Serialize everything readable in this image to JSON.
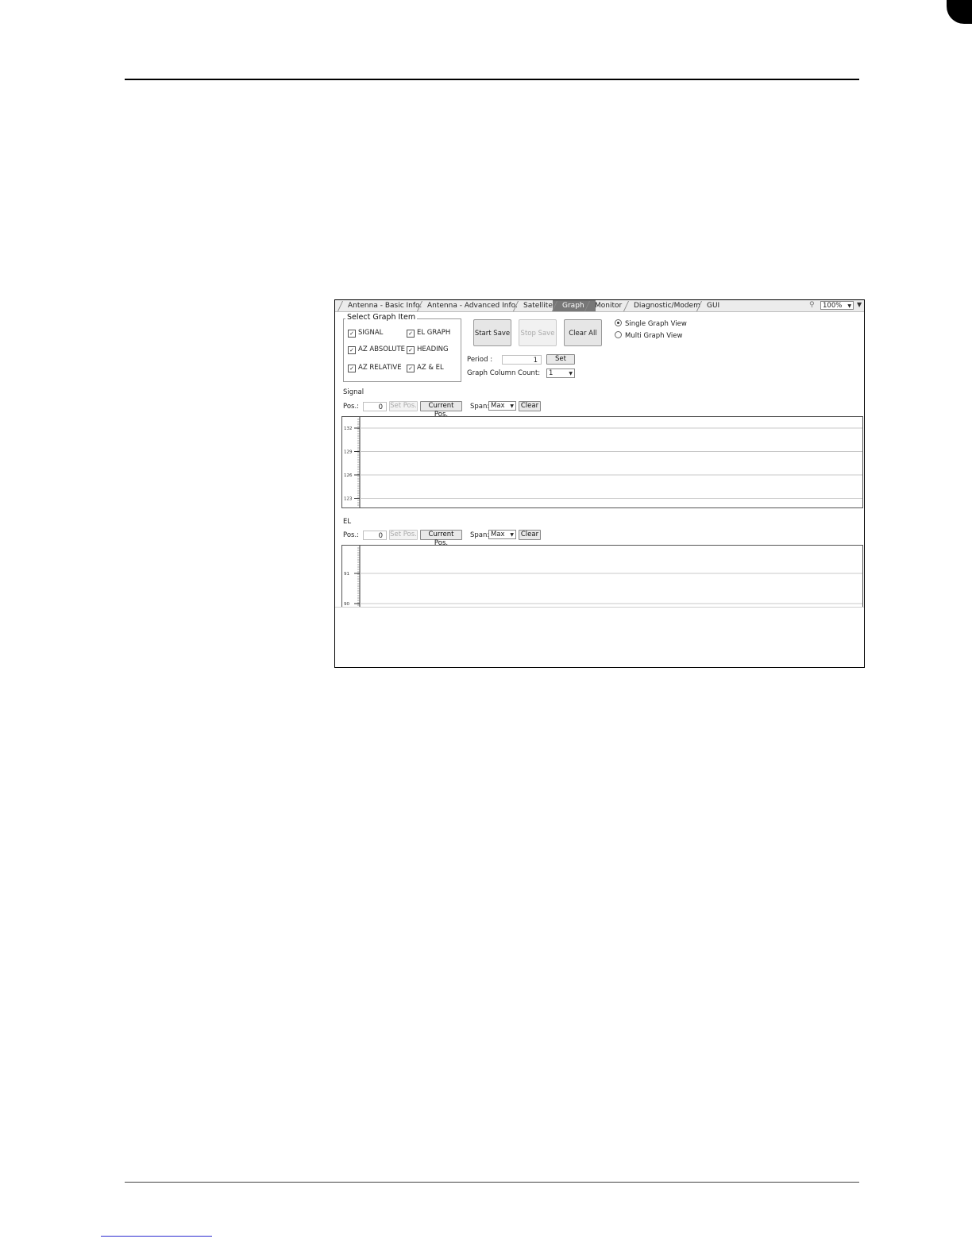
{
  "tabs": [
    {
      "label": "Antenna - Basic Info.",
      "active": false
    },
    {
      "label": "Antenna - Advanced Info.",
      "active": false
    },
    {
      "label": "Satellite",
      "active": false
    },
    {
      "label": "Graph",
      "active": true
    },
    {
      "label": "Monitor",
      "active": false
    },
    {
      "label": "Diagnostic/Modem",
      "active": false
    },
    {
      "label": "GUI",
      "active": false
    }
  ],
  "zoom": {
    "value": "100%"
  },
  "select_graph_item": {
    "title": "Select Graph Item",
    "items": [
      {
        "label": "SIGNAL",
        "checked": true
      },
      {
        "label": "EL GRAPH",
        "checked": true
      },
      {
        "label": "AZ ABSOLUTE",
        "checked": true
      },
      {
        "label": "HEADING",
        "checked": true
      },
      {
        "label": "AZ RELATIVE",
        "checked": true
      },
      {
        "label": "AZ & EL",
        "checked": true
      }
    ]
  },
  "buttons": {
    "start_save": "Start Save",
    "stop_save": "Stop Save",
    "clear_all": "Clear All"
  },
  "view_mode": {
    "single": "Single Graph View",
    "multi": "Multi Graph View",
    "selected": "single"
  },
  "period": {
    "label": "Period :",
    "value": "1",
    "set_label": "Set"
  },
  "column_count": {
    "label": "Graph Column Count:",
    "value": "1"
  },
  "signal_panel": {
    "title": "Signal",
    "pos_label": "Pos.:",
    "pos_value": "0",
    "set_pos": "Set Pos.",
    "current_pos": "Current Pos.",
    "span_label": "Span:",
    "span_value": "Max",
    "clear": "Clear",
    "y_ticks": [
      "132",
      "129",
      "126",
      "123"
    ]
  },
  "el_panel": {
    "title": "EL",
    "pos_label": "Pos.:",
    "pos_value": "0",
    "set_pos": "Set Pos.",
    "current_pos": "Current Pos.",
    "span_label": "Span:",
    "span_value": "Max",
    "clear": "Clear",
    "y_ticks": [
      "91",
      "90"
    ]
  }
}
